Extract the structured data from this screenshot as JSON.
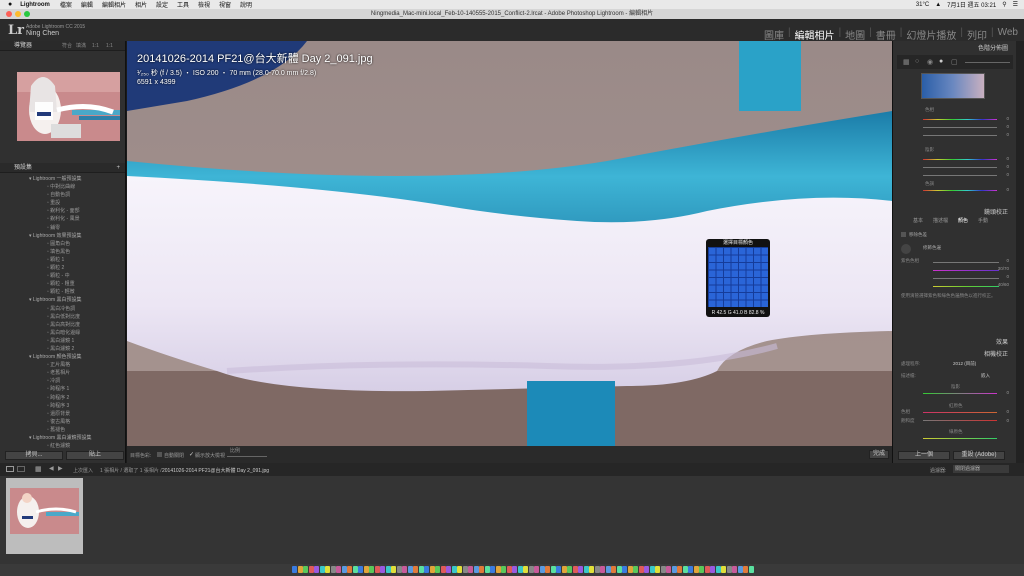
{
  "menubar": {
    "apple": "",
    "app": "Lightroom",
    "items": [
      "檔案",
      "編輯",
      "編輯相片",
      "相片",
      "設定",
      "工具",
      "檢視",
      "視窗",
      "說明"
    ],
    "temp": "31°C",
    "date_time": "7月1日 週五 03:21"
  },
  "window": {
    "title": "Ningmedia_Mac-mini.local_Feb-10-140555-2015_Conflict-2.lrcat - Adobe Photoshop Lightroom - 編輯相片"
  },
  "identity": {
    "logo": "Lr",
    "product": "Adobe Lightroom CC 2015",
    "user": "Ning Chen"
  },
  "modules": [
    "圖庫",
    "編輯相片",
    "地圖",
    "書冊",
    "幻燈片播放",
    "列印",
    "Web"
  ],
  "left_panel": {
    "navigator": "導覽器",
    "nav_zoom": [
      "符合",
      "填滿",
      "1:1",
      "1:1"
    ],
    "presets_header": "預設集",
    "presets": [
      {
        "type": "folder",
        "label": "Lightroom 一般預設集"
      },
      {
        "type": "item",
        "label": "中對比曲線"
      },
      {
        "type": "item",
        "label": "自動色調"
      },
      {
        "type": "item",
        "label": "重設"
      },
      {
        "type": "item",
        "label": "銳利化 - 面部"
      },
      {
        "type": "item",
        "label": "銳利化 - 風景"
      },
      {
        "type": "item",
        "label": "鋪零"
      },
      {
        "type": "folder",
        "label": "Lightroom 效果預設集"
      },
      {
        "type": "item",
        "label": "圓角白色"
      },
      {
        "type": "item",
        "label": "填色黑色"
      },
      {
        "type": "item",
        "label": "顆粒 1"
      },
      {
        "type": "item",
        "label": "顆粒 2"
      },
      {
        "type": "item",
        "label": "顆粒 - 中"
      },
      {
        "type": "item",
        "label": "顆粒 - 粗重"
      },
      {
        "type": "item",
        "label": "顆粒 - 輕微"
      },
      {
        "type": "folder",
        "label": "Lightroom 黑白預設集"
      },
      {
        "type": "item",
        "label": "黑白冷色調"
      },
      {
        "type": "item",
        "label": "黑白低對比度"
      },
      {
        "type": "item",
        "label": "黑白高對比度"
      },
      {
        "type": "item",
        "label": "黑白暗化邊緣"
      },
      {
        "type": "item",
        "label": "黑白濾鏡 1"
      },
      {
        "type": "item",
        "label": "黑白濾鏡 2"
      },
      {
        "type": "folder",
        "label": "Lightroom 顏色預設集"
      },
      {
        "type": "item",
        "label": "正片風格"
      },
      {
        "type": "item",
        "label": "老舊相片"
      },
      {
        "type": "item",
        "label": "冷調"
      },
      {
        "type": "item",
        "label": "跨程序 1"
      },
      {
        "type": "item",
        "label": "跨程序 2"
      },
      {
        "type": "item",
        "label": "跨程序 3"
      },
      {
        "type": "item",
        "label": "還原背景"
      },
      {
        "type": "item",
        "label": "復古風格"
      },
      {
        "type": "item",
        "label": "舊褪色"
      },
      {
        "type": "folder",
        "label": "Lightroom 黑白濾鏡預設集"
      },
      {
        "type": "item",
        "label": "紅色濾鏡"
      }
    ],
    "copy_btn": "拷貝...",
    "paste_btn": "貼上"
  },
  "photo": {
    "filename": "20141026-2014 PF21@台大新體 Day 2_091.jpg",
    "exposure": "¹⁄₂₅₀ 秒 (f / 3.5) ・ ISO 200 ・ 70 mm (28.0-70.0 mm f/2.8)",
    "dimensions": "6591 x 4399"
  },
  "loupe": {
    "title": "選擇目標顏色",
    "values": "R 42.5  G 41.0  B 82.8 %"
  },
  "toolbar": {
    "target": "目標色彩:",
    "auto": "自動關閉",
    "show_loupe": "顯示放大檢視",
    "scale": "比例",
    "done": "完成"
  },
  "right_panel": {
    "color_header": "色階分佈圖",
    "split_header": "鏡頭校正",
    "tabs": [
      "基本",
      "描述檔",
      "顏色",
      "手動"
    ],
    "remove_ca": "移除色差",
    "defringe": "修飾色邊",
    "purple_amount_label": "紫色色相",
    "purple_amount": "0",
    "purple_hue": "30/70",
    "green_amount": "0",
    "green_hue": "40/60",
    "hint": "使用滴管選擇紫色和綠色色邊顏色以進行校正。",
    "effects_header": "效果",
    "camera_header": "相機校正",
    "process_label": "處理程序:",
    "process_value": "2012 (目前)",
    "profile_label": "描述檔:",
    "profile_value": "嵌入",
    "shadows_label": "陰影",
    "tint_label": "色調",
    "red_primary": "紅原色",
    "green_primary": "綠原色",
    "hue_label": "色相",
    "sat_label": "飽和度",
    "zero": "0",
    "prev_btn": "上一個",
    "reset_btn": "重設 (Adobe)"
  },
  "filmstrip_bar": {
    "nav": "上次匯入",
    "count": "1 張相片 / 選取了 1 張相片 /",
    "file": "20141026-2014 PF21@台大新體 Day 2_091.jpg",
    "filter_label": "過濾器:",
    "filter_value": "關閉過濾器"
  },
  "colors": {
    "bg": "#303030",
    "loupe_blue": "#2a65d8",
    "accent": "#e9e9e9"
  }
}
